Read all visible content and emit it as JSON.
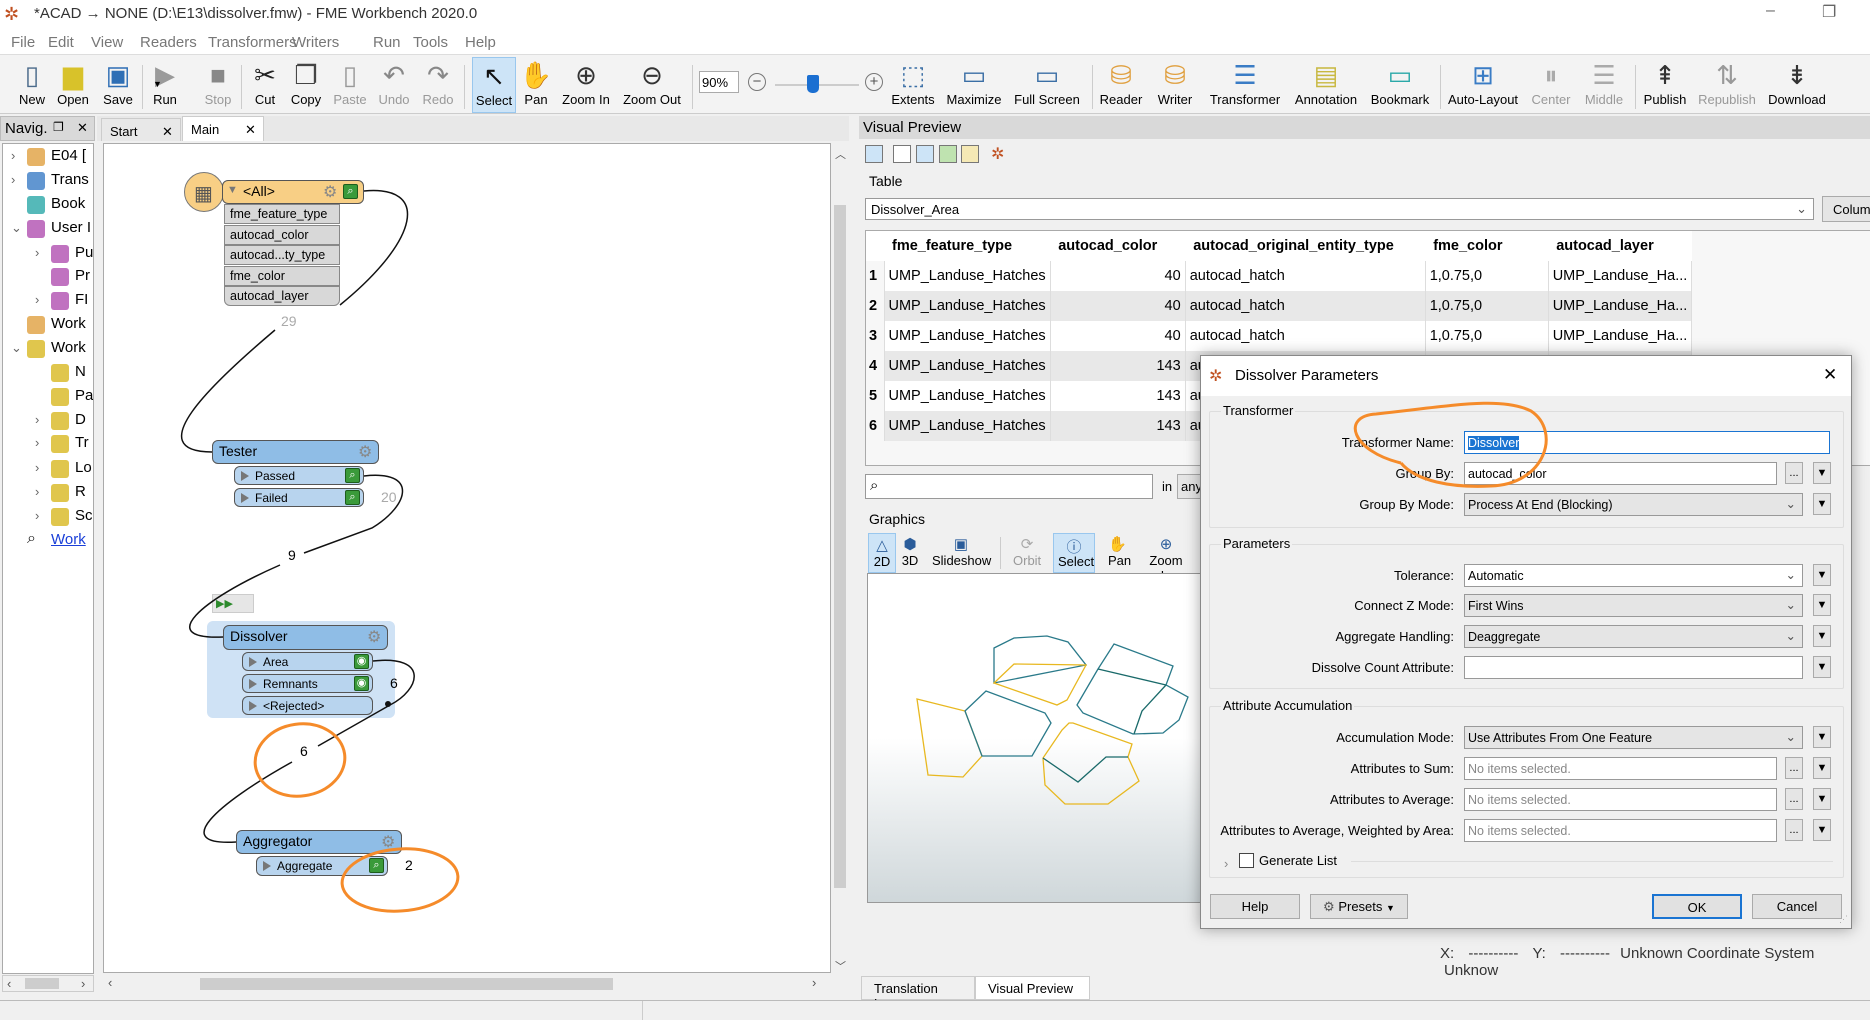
{
  "window": {
    "title": "*ACAD → NONE (D:\\E13\\dissolver.fmw) - FME Workbench 2020.0",
    "minimize": "–",
    "restore": "❐"
  },
  "menu": [
    "File",
    "Edit",
    "View",
    "Readers",
    "Transformers",
    "Writers",
    "Run",
    "Tools",
    "Help"
  ],
  "toolbar": {
    "items": [
      {
        "label": "New",
        "icon": "new-file-icon",
        "glyph": "▯",
        "color": "#4a6a8a",
        "enabled": true
      },
      {
        "label": "Open",
        "icon": "open-folder-icon",
        "glyph": "▆",
        "color": "#d8c22a",
        "enabled": true
      },
      {
        "label": "Save",
        "icon": "save-icon",
        "glyph": "▣",
        "color": "#2f6fb5",
        "enabled": true
      },
      {
        "label": "Run",
        "icon": "run-icon",
        "glyph": "▶",
        "color": "#9a9a9a",
        "enabled": true
      },
      {
        "label": "Stop",
        "icon": "stop-icon",
        "glyph": "■",
        "color": "#888",
        "enabled": false
      },
      {
        "label": "Cut",
        "icon": "cut-icon",
        "glyph": "✂",
        "color": "#222",
        "enabled": true
      },
      {
        "label": "Copy",
        "icon": "copy-icon",
        "glyph": "❐",
        "color": "#444",
        "enabled": true
      },
      {
        "label": "Paste",
        "icon": "paste-icon",
        "glyph": "▯",
        "color": "#999",
        "enabled": false
      },
      {
        "label": "Undo",
        "icon": "undo-icon",
        "glyph": "↶",
        "color": "#888",
        "enabled": false
      },
      {
        "label": "Redo",
        "icon": "redo-icon",
        "glyph": "↷",
        "color": "#888",
        "enabled": false
      },
      {
        "label": "Select",
        "icon": "select-cursor-icon",
        "glyph": "↖",
        "color": "#111",
        "enabled": true,
        "active": true
      },
      {
        "label": "Pan",
        "icon": "pan-hand-icon",
        "glyph": "✋",
        "color": "#333",
        "enabled": true
      },
      {
        "label": "Zoom In",
        "icon": "zoom-in-icon",
        "glyph": "⊕",
        "color": "#333",
        "enabled": true
      },
      {
        "label": "Zoom Out",
        "icon": "zoom-out-icon",
        "glyph": "⊖",
        "color": "#333",
        "enabled": true
      },
      {
        "label": "Extents",
        "icon": "extents-icon",
        "glyph": "⬚",
        "color": "#3a6ea5",
        "enabled": true
      },
      {
        "label": "Maximize",
        "icon": "maximize-icon",
        "glyph": "▭",
        "color": "#3a6ea5",
        "enabled": true
      },
      {
        "label": "Full Screen",
        "icon": "full-screen-icon",
        "glyph": "▭",
        "color": "#3a6ea5",
        "enabled": true
      },
      {
        "label": "Reader",
        "icon": "add-reader-icon",
        "glyph": "⛁",
        "color": "#e0a040",
        "enabled": true
      },
      {
        "label": "Writer",
        "icon": "add-writer-icon",
        "glyph": "⛁",
        "color": "#e0a040",
        "enabled": true
      },
      {
        "label": "Transformer",
        "icon": "add-transformer-icon",
        "glyph": "☰",
        "color": "#3a7cc5",
        "enabled": true
      },
      {
        "label": "Annotation",
        "icon": "add-annotation-icon",
        "glyph": "▤",
        "color": "#c8b840",
        "enabled": true
      },
      {
        "label": "Bookmark",
        "icon": "add-bookmark-icon",
        "glyph": "▭",
        "color": "#2aa8a8",
        "enabled": true
      },
      {
        "label": "Auto-Layout",
        "icon": "auto-layout-icon",
        "glyph": "⊞",
        "color": "#3a7cc5",
        "enabled": true
      },
      {
        "label": "Center",
        "icon": "align-center-icon",
        "glyph": "⏸",
        "color": "#aaa",
        "enabled": false
      },
      {
        "label": "Middle",
        "icon": "align-middle-icon",
        "glyph": "☰",
        "color": "#aaa",
        "enabled": false
      },
      {
        "label": "Publish",
        "icon": "publish-icon",
        "glyph": "⇞",
        "color": "#333",
        "enabled": true
      },
      {
        "label": "Republish",
        "icon": "republish-icon",
        "glyph": "⇅",
        "color": "#999",
        "enabled": false
      },
      {
        "label": "Download",
        "icon": "download-icon",
        "glyph": "⇟",
        "color": "#333",
        "enabled": true
      }
    ],
    "zoom_level": "90%",
    "zoom_slider_fraction": 0.45,
    "zoom_minus": "−",
    "zoom_plus": "+"
  },
  "navigator": {
    "title": "Navig.",
    "close": "✕",
    "items": [
      {
        "label": "E04 [",
        "icon": "reader-icon",
        "color": "#e0a040",
        "level": 0,
        "expander": "›"
      },
      {
        "label": "Trans",
        "icon": "transformers-icon",
        "color": "#3a7cc5",
        "level": 0,
        "expander": "›"
      },
      {
        "label": "Book",
        "icon": "bookmark-icon",
        "color": "#2aa8a8",
        "level": 0,
        "expander": ""
      },
      {
        "label": "User I",
        "icon": "user-parameters-icon",
        "color": "#b04fb0",
        "level": 0,
        "expander": "⌄"
      },
      {
        "label": "Pu",
        "icon": "user-parameter-icon",
        "color": "#b04fb0",
        "level": 1,
        "expander": "›"
      },
      {
        "label": "Pr",
        "icon": "private-parameter-icon",
        "color": "#b04fb0",
        "level": 1,
        "expander": ""
      },
      {
        "label": "FI",
        "icon": "fme-parameter-icon",
        "color": "#b04fb0",
        "level": 1,
        "expander": "›"
      },
      {
        "label": "Work",
        "icon": "workspace-resources-icon",
        "color": "#e0a040",
        "level": 0,
        "expander": ""
      },
      {
        "label": "Work",
        "icon": "workspace-parameters-icon",
        "color": "#d8b820",
        "level": 0,
        "expander": "⌄"
      },
      {
        "label": "N",
        "icon": "parameter-gear-icon",
        "color": "#d8b820",
        "level": 1,
        "expander": ""
      },
      {
        "label": "Pa",
        "icon": "parameter-gear-icon",
        "color": "#d8b820",
        "level": 1,
        "expander": ""
      },
      {
        "label": "D",
        "icon": "parameter-gear-icon",
        "color": "#d8b820",
        "level": 1,
        "expander": "›"
      },
      {
        "label": "Tr",
        "icon": "parameter-gear-icon",
        "color": "#d8b820",
        "level": 1,
        "expander": "›"
      },
      {
        "label": "Lo",
        "icon": "parameter-gear-icon",
        "color": "#d8b820",
        "level": 1,
        "expander": "›"
      },
      {
        "label": "R",
        "icon": "parameter-gear-icon",
        "color": "#d8b820",
        "level": 1,
        "expander": "›"
      },
      {
        "label": "Sc",
        "icon": "parameter-gear-icon",
        "color": "#d8b820",
        "level": 1,
        "expander": "›"
      },
      {
        "label": "Work",
        "icon": "search-icon",
        "color": "#333",
        "level": 0,
        "expander": "",
        "link": true
      }
    ]
  },
  "canvas": {
    "tabs": [
      {
        "label": "Start",
        "close": "✕"
      },
      {
        "label": "Main",
        "close": "✕"
      }
    ],
    "reader": {
      "name": "<All>",
      "attributes": [
        "fme_feature_type",
        "autocad_color",
        "autocad...ty_type",
        "fme_color",
        "autocad_layer"
      ]
    },
    "tester": {
      "name": "Tester",
      "ports": [
        "Passed",
        "Failed"
      ]
    },
    "dissolver": {
      "name": "Dissolver",
      "ports": [
        "Area",
        "Remnants",
        "<Rejected>"
      ]
    },
    "aggregator": {
      "name": "Aggregator",
      "ports": [
        "Aggregate"
      ]
    },
    "counts": {
      "reader_out": "29",
      "tester_failed": "20",
      "tester_passed": "9",
      "dissolver_remnants": "6",
      "dissolver_area": "6",
      "aggregate": "2"
    }
  },
  "visual_preview": {
    "title": "Visual Preview",
    "table_label": "Table",
    "layer": "Dissolver_Area",
    "columns_button": "Colum",
    "columns": [
      "fme_feature_type",
      "autocad_color",
      "autocad_original_entity_type",
      "fme_color",
      "autocad_layer"
    ],
    "rows": [
      [
        "1",
        "UMP_Landuse_Hatches",
        "40",
        "autocad_hatch",
        "1,0.75,0",
        "UMP_Landuse_Ha..."
      ],
      [
        "2",
        "UMP_Landuse_Hatches",
        "40",
        "autocad_hatch",
        "1,0.75,0",
        "UMP_Landuse_Ha..."
      ],
      [
        "3",
        "UMP_Landuse_Hatches",
        "40",
        "autocad_hatch",
        "1,0.75,0",
        "UMP_Landuse_Ha..."
      ],
      [
        "4",
        "UMP_Landuse_Hatches",
        "143",
        "au",
        "",
        ""
      ],
      [
        "5",
        "UMP_Landuse_Hatches",
        "143",
        "au",
        "",
        ""
      ],
      [
        "6",
        "UMP_Landuse_Hatches",
        "143",
        "au",
        "",
        ""
      ]
    ],
    "search_in": "in",
    "search_scope": "any",
    "graphics_label": "Graphics",
    "graphics_tools": [
      {
        "label": "2D",
        "icon": "2d-view-icon",
        "glyph": "△",
        "active": true
      },
      {
        "label": "3D",
        "icon": "3d-view-icon",
        "glyph": "⬢"
      },
      {
        "label": "Slideshow",
        "icon": "slideshow-icon",
        "glyph": "▣"
      },
      {
        "label": "Orbit",
        "icon": "orbit-icon",
        "glyph": "⟳",
        "disabled": true
      },
      {
        "label": "Select",
        "icon": "select-info-icon",
        "glyph": "ⓘ",
        "active": true
      },
      {
        "label": "Pan",
        "icon": "pan-hand-icon",
        "glyph": "✋"
      },
      {
        "label": "Zoom In",
        "icon": "zoom-in-icon",
        "glyph": "⊕"
      }
    ],
    "feature_colors": {
      "group_40": "#e8b820",
      "group_143": "#2a7a8a"
    },
    "coords": {
      "x_label": "X:",
      "x_value": "----------",
      "y_label": "Y:",
      "y_value": "----------",
      "crs": "Unknown Coordinate System",
      "units": "Unknow"
    },
    "bottom_tabs": [
      "Translation Log",
      "Visual Preview"
    ]
  },
  "dialog": {
    "title": "Dissolver Parameters",
    "close": "✕",
    "sections": {
      "transformer": "Transformer",
      "parameters": "Parameters",
      "accumulation": "Attribute Accumulation"
    },
    "fields": {
      "transformer_name": {
        "label": "Transformer Name:",
        "value": "Dissolver"
      },
      "group_by": {
        "label": "Group By:",
        "value": "autocad_color"
      },
      "group_by_mode": {
        "label": "Group By Mode:",
        "value": "Process At End (Blocking)"
      },
      "tolerance": {
        "label": "Tolerance:",
        "value": "Automatic"
      },
      "connect_z": {
        "label": "Connect Z Mode:",
        "value": "First Wins"
      },
      "aggregate_handling": {
        "label": "Aggregate Handling:",
        "value": "Deaggregate"
      },
      "dissolve_count": {
        "label": "Dissolve Count Attribute:",
        "value": ""
      },
      "accumulation_mode": {
        "label": "Accumulation Mode:",
        "value": "Use Attributes From One Feature"
      },
      "sum": {
        "label": "Attributes to Sum:",
        "placeholder": "No items selected."
      },
      "average": {
        "label": "Attributes to Average:",
        "placeholder": "No items selected."
      },
      "weighted": {
        "label": "Attributes to Average, Weighted by Area:",
        "placeholder": "No items selected."
      }
    },
    "generate_list": {
      "label": "Generate List",
      "checked": false
    },
    "buttons": {
      "help": "Help",
      "presets": "Presets",
      "ok": "OK",
      "cancel": "Cancel"
    },
    "ellipsis": "...",
    "menu_arrow": "▼",
    "chevron": "⌄"
  },
  "annotation_color": "#f58b2a"
}
